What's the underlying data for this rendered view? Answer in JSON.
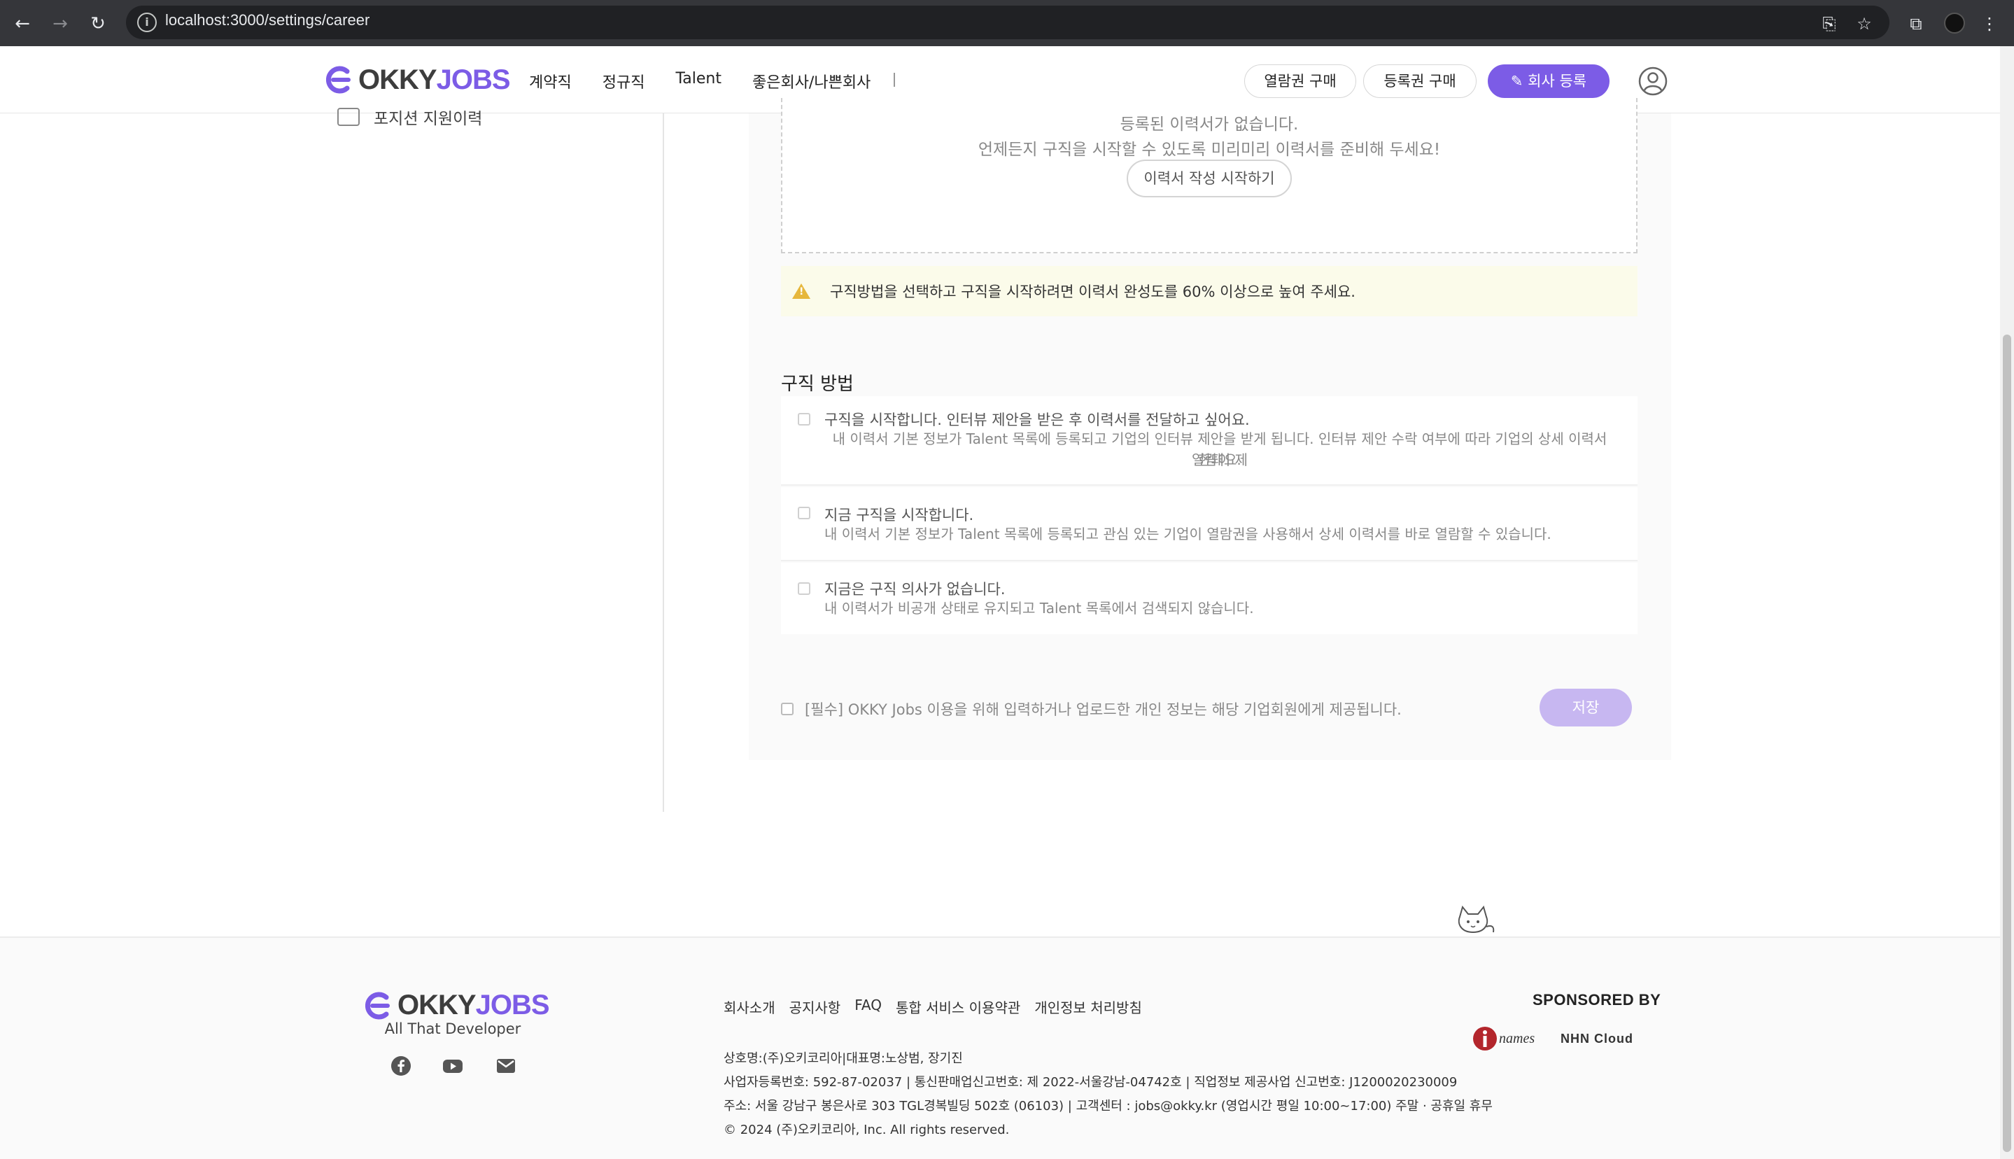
{
  "browser": {
    "url": "localhost:3000/settings/career"
  },
  "header": {
    "logo_okky": "OKKY",
    "logo_jobs": "JOBS",
    "nav": [
      "계약직",
      "정규직",
      "Talent",
      "좋은회사/나쁜회사"
    ],
    "btn_view_pass": "열람권 구매",
    "btn_register_pass": "등록권 구매",
    "btn_company_register": "회사 등록"
  },
  "sidebar": {
    "position_history": "포지션 지원이력"
  },
  "resume": {
    "empty_line1": "등록된 이력서가 없습니다.",
    "empty_line2": "언제든지 구직을 시작할 수 있도록 미리미리 이력서를 준비해 두세요!",
    "start_button": "이력서 작성 시작하기"
  },
  "warning": {
    "text": "구직방법을 선택하고 구직을 시작하려면 이력서 완성도를 60% 이상으로 높여 주세요."
  },
  "job_method": {
    "title": "구직 방법",
    "options": [
      {
        "title": "구직을 시작합니다. 인터뷰 제안을 받은 후 이력서를 전달하고 싶어요.",
        "desc_line1": "내 이력서 기본 정보가 Talent 목록에 등록되고 기업의 인터뷰 제안을 받게 됩니다. 인터뷰 제안 수락 여부에 따라 기업의 상세 이력서 열람이 제",
        "desc_line2": "한돼요."
      },
      {
        "title": "지금 구직을 시작합니다.",
        "desc_line1": "내 이력서 기본 정보가 Talent 목록에 등록되고 관심 있는 기업이 열람권을 사용해서 상세 이력서를 바로 열람할 수 있습니다."
      },
      {
        "title": "지금은 구직 의사가 없습니다.",
        "desc_line1": "내 이력서가 비공개 상태로 유지되고 Talent 목록에서 검색되지 않습니다."
      }
    ]
  },
  "consent": {
    "text": "[필수] OKKY Jobs 이용을 위해 입력하거나 업로드한 개인 정보는 해당 기업회원에게 제공됩니다.",
    "save": "저장"
  },
  "footer": {
    "tagline": "All That Developer",
    "links": [
      "회사소개",
      "공지사항",
      "FAQ",
      "통합 서비스 이용약관",
      "개인정보 처리방침"
    ],
    "info": [
      "상호명:(주)오키코리아|대표명:노상범, 장기진",
      "사업자등록번호: 592-87-02037 | 통신판매업신고번호: 제 2022-서울강남-04742호 | 직업정보 제공사업 신고번호: J1200020230009",
      "주소: 서울 강남구 봉은사로 303 TGL경복빌딩 502호 (06103) | 고객센터 : jobs@okky.kr (영업시간 평일 10:00~17:00) 주말 · 공휴일 휴무",
      "© 2024 (주)오키코리아, Inc. All rights reserved."
    ],
    "sponsored_by": "SPONSORED BY",
    "sponsor1": "names",
    "sponsor2": "NHN Cloud"
  },
  "colors": {
    "brand": "#7c5ce6",
    "save_disabled": "#c7b7f1",
    "warning_bg": "#fbfbea",
    "warning_icon": "#e6b73c"
  }
}
